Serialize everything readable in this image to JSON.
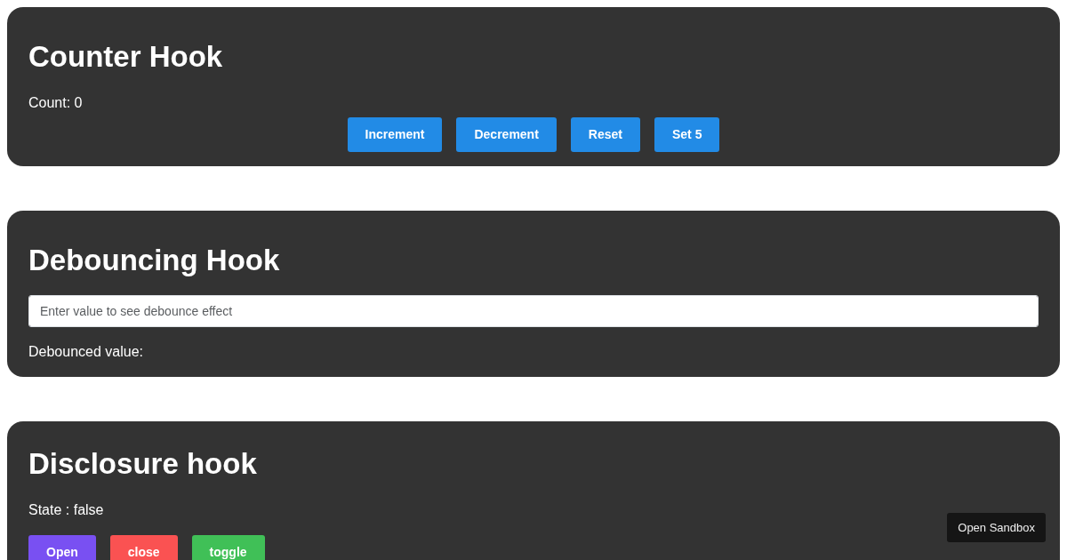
{
  "counter": {
    "title": "Counter Hook",
    "count_text": "Count: 0",
    "buttons": [
      {
        "label": "Increment",
        "color": "#228be6"
      },
      {
        "label": "Decrement",
        "color": "#228be6"
      },
      {
        "label": "Reset",
        "color": "#228be6"
      },
      {
        "label": "Set 5",
        "color": "#228be6"
      }
    ]
  },
  "debounce": {
    "title": "Debouncing Hook",
    "input": {
      "placeholder": "Enter value to see debounce effect"
    },
    "result_text": "Debounced value:"
  },
  "disclosure": {
    "title": "Disclosure hook",
    "state_text": "State : false",
    "buttons": [
      {
        "label": "Open",
        "color": "#7950f2"
      },
      {
        "label": "close",
        "color": "#fa5252"
      },
      {
        "label": "toggle",
        "color": "#40c057"
      }
    ]
  },
  "sandbox_button": "Open Sandbox"
}
